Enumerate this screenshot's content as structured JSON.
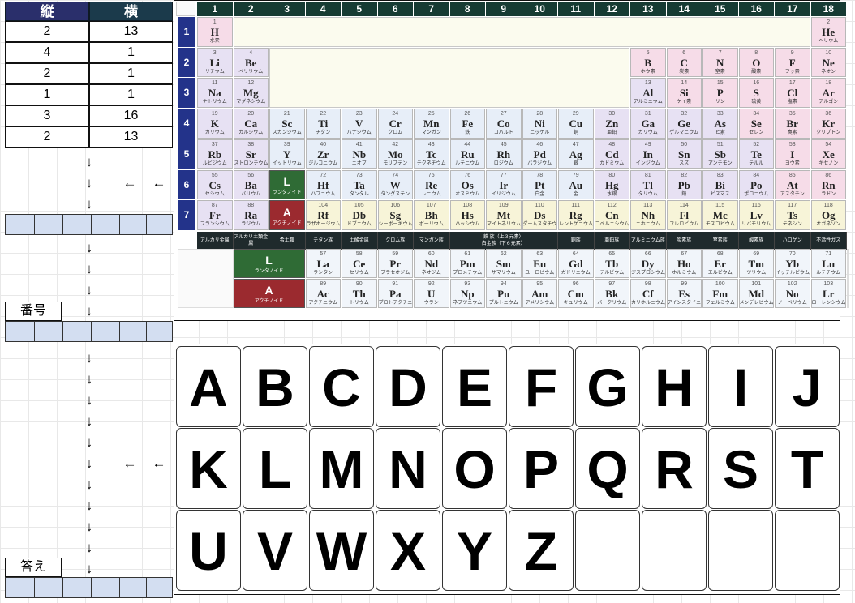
{
  "left": {
    "headers": [
      "縦",
      "横"
    ],
    "coords": [
      [
        "2",
        "13"
      ],
      [
        "4",
        "1"
      ],
      [
        "2",
        "1"
      ],
      [
        "1",
        "1"
      ],
      [
        "3",
        "16"
      ],
      [
        "2",
        "13"
      ]
    ],
    "down_arrow": "↓",
    "left_arrow": "←",
    "label_number": "番号",
    "label_answer": "答え"
  },
  "columns": [
    "1",
    "2",
    "3",
    "4",
    "5",
    "6",
    "7",
    "8",
    "9",
    "10",
    "11",
    "12",
    "13",
    "14",
    "15",
    "16",
    "17",
    "18"
  ],
  "periods": [
    "1",
    "2",
    "3",
    "4",
    "5",
    "6",
    "7"
  ],
  "elements": [
    [
      1,
      1,
      "1",
      "H",
      "水素",
      "hal"
    ],
    [
      1,
      18,
      "2",
      "He",
      "ヘリウム",
      "hal"
    ],
    [
      2,
      1,
      "3",
      "Li",
      "リチウム",
      "ak"
    ],
    [
      2,
      2,
      "4",
      "Be",
      "ベリリウム",
      "ak"
    ],
    [
      2,
      13,
      "5",
      "B",
      "ホウ素",
      "hal"
    ],
    [
      2,
      14,
      "6",
      "C",
      "炭素",
      "hal"
    ],
    [
      2,
      15,
      "7",
      "N",
      "窒素",
      "hal"
    ],
    [
      2,
      16,
      "8",
      "O",
      "酸素",
      "hal"
    ],
    [
      2,
      17,
      "9",
      "F",
      "フッ素",
      "hal"
    ],
    [
      2,
      18,
      "10",
      "Ne",
      "ネオン",
      "hal"
    ],
    [
      3,
      1,
      "11",
      "Na",
      "ナトリウム",
      "ak"
    ],
    [
      3,
      2,
      "12",
      "Mg",
      "マグネシウム",
      "ak"
    ],
    [
      3,
      13,
      "13",
      "Al",
      "アルミニウム",
      "ak"
    ],
    [
      3,
      14,
      "14",
      "Si",
      "ケイ素",
      "hal"
    ],
    [
      3,
      15,
      "15",
      "P",
      "リン",
      "hal"
    ],
    [
      3,
      16,
      "16",
      "S",
      "硫黄",
      "hal"
    ],
    [
      3,
      17,
      "17",
      "Cl",
      "塩素",
      "hal"
    ],
    [
      3,
      18,
      "18",
      "Ar",
      "アルゴン",
      "hal"
    ],
    [
      4,
      1,
      "19",
      "K",
      "カリウム",
      "ak"
    ],
    [
      4,
      2,
      "20",
      "Ca",
      "カルシウム",
      "ak"
    ],
    [
      4,
      3,
      "21",
      "Sc",
      "スカンジウム",
      "tm"
    ],
    [
      4,
      4,
      "22",
      "Ti",
      "チタン",
      "tm"
    ],
    [
      4,
      5,
      "23",
      "V",
      "バナジウム",
      "tm"
    ],
    [
      4,
      6,
      "24",
      "Cr",
      "クロム",
      "tm"
    ],
    [
      4,
      7,
      "25",
      "Mn",
      "マンガン",
      "tm"
    ],
    [
      4,
      8,
      "26",
      "Fe",
      "鉄",
      "tm"
    ],
    [
      4,
      9,
      "27",
      "Co",
      "コバルト",
      "tm"
    ],
    [
      4,
      10,
      "28",
      "Ni",
      "ニッケル",
      "tm"
    ],
    [
      4,
      11,
      "29",
      "Cu",
      "銅",
      "tm"
    ],
    [
      4,
      12,
      "30",
      "Zn",
      "亜鉛",
      "ak"
    ],
    [
      4,
      13,
      "31",
      "Ga",
      "ガリウム",
      "ak"
    ],
    [
      4,
      14,
      "32",
      "Ge",
      "ゲルマニウム",
      "ak"
    ],
    [
      4,
      15,
      "33",
      "As",
      "ヒ素",
      "ak"
    ],
    [
      4,
      16,
      "34",
      "Se",
      "セレン",
      "hal"
    ],
    [
      4,
      17,
      "35",
      "Br",
      "臭素",
      "hal"
    ],
    [
      4,
      18,
      "36",
      "Kr",
      "クリプトン",
      "hal"
    ],
    [
      5,
      1,
      "37",
      "Rb",
      "ルビジウム",
      "ak"
    ],
    [
      5,
      2,
      "38",
      "Sr",
      "ストロンチウム",
      "ak"
    ],
    [
      5,
      3,
      "39",
      "Y",
      "イットリウム",
      "tm"
    ],
    [
      5,
      4,
      "40",
      "Zr",
      "ジルコニウム",
      "tm"
    ],
    [
      5,
      5,
      "41",
      "Nb",
      "ニオブ",
      "tm"
    ],
    [
      5,
      6,
      "42",
      "Mo",
      "モリブデン",
      "tm"
    ],
    [
      5,
      7,
      "43",
      "Tc",
      "テクネチウム",
      "tm"
    ],
    [
      5,
      8,
      "44",
      "Ru",
      "ルテニウム",
      "tm"
    ],
    [
      5,
      9,
      "45",
      "Rh",
      "ロジウム",
      "tm"
    ],
    [
      5,
      10,
      "46",
      "Pd",
      "パラジウム",
      "tm"
    ],
    [
      5,
      11,
      "47",
      "Ag",
      "銀",
      "tm"
    ],
    [
      5,
      12,
      "48",
      "Cd",
      "カドミウム",
      "ak"
    ],
    [
      5,
      13,
      "49",
      "In",
      "インジウム",
      "ak"
    ],
    [
      5,
      14,
      "50",
      "Sn",
      "スズ",
      "ak"
    ],
    [
      5,
      15,
      "51",
      "Sb",
      "アンチモン",
      "ak"
    ],
    [
      5,
      16,
      "52",
      "Te",
      "テルル",
      "ak"
    ],
    [
      5,
      17,
      "53",
      "I",
      "ヨウ素",
      "hal"
    ],
    [
      5,
      18,
      "54",
      "Xe",
      "キセノン",
      "hal"
    ],
    [
      6,
      1,
      "55",
      "Cs",
      "セシウム",
      "ak"
    ],
    [
      6,
      2,
      "56",
      "Ba",
      "バリウム",
      "ak"
    ],
    [
      6,
      4,
      "72",
      "Hf",
      "ハフニウム",
      "tm"
    ],
    [
      6,
      5,
      "73",
      "Ta",
      "タンタル",
      "tm"
    ],
    [
      6,
      6,
      "74",
      "W",
      "タングステン",
      "tm"
    ],
    [
      6,
      7,
      "75",
      "Re",
      "レニウム",
      "tm"
    ],
    [
      6,
      8,
      "76",
      "Os",
      "オスミウム",
      "tm"
    ],
    [
      6,
      9,
      "77",
      "Ir",
      "イリジウム",
      "tm"
    ],
    [
      6,
      10,
      "78",
      "Pt",
      "白金",
      "tm"
    ],
    [
      6,
      11,
      "79",
      "Au",
      "金",
      "tm"
    ],
    [
      6,
      12,
      "80",
      "Hg",
      "水銀",
      "ak"
    ],
    [
      6,
      13,
      "81",
      "Tl",
      "タリウム",
      "ak"
    ],
    [
      6,
      14,
      "82",
      "Pb",
      "鉛",
      "ak"
    ],
    [
      6,
      15,
      "83",
      "Bi",
      "ビスマス",
      "ak"
    ],
    [
      6,
      16,
      "84",
      "Po",
      "ポロニウム",
      "ak"
    ],
    [
      6,
      17,
      "85",
      "At",
      "アスタチン",
      "hal"
    ],
    [
      6,
      18,
      "86",
      "Rn",
      "ラドン",
      "hal"
    ],
    [
      7,
      1,
      "87",
      "Fr",
      "フランシウム",
      "ak"
    ],
    [
      7,
      2,
      "88",
      "Ra",
      "ラジウム",
      "ak"
    ],
    [
      7,
      4,
      "104",
      "Rf",
      "ラザホージウム",
      "sh"
    ],
    [
      7,
      5,
      "105",
      "Db",
      "ドブニウム",
      "sh"
    ],
    [
      7,
      6,
      "106",
      "Sg",
      "シーボーギウム",
      "sh"
    ],
    [
      7,
      7,
      "107",
      "Bh",
      "ボーリウム",
      "sh"
    ],
    [
      7,
      8,
      "108",
      "Hs",
      "ハッシウム",
      "sh"
    ],
    [
      7,
      9,
      "109",
      "Mt",
      "マイトネリウム",
      "sh"
    ],
    [
      7,
      10,
      "110",
      "Ds",
      "ダームスタチウム",
      "sh"
    ],
    [
      7,
      11,
      "111",
      "Rg",
      "レントゲニウム",
      "sh"
    ],
    [
      7,
      12,
      "112",
      "Cn",
      "コペルニシウム",
      "sh"
    ],
    [
      7,
      13,
      "113",
      "Nh",
      "ニホニウム",
      "sh"
    ],
    [
      7,
      14,
      "114",
      "Fl",
      "フレロビウム",
      "sh"
    ],
    [
      7,
      15,
      "115",
      "Mc",
      "モスコビウム",
      "sh"
    ],
    [
      7,
      16,
      "116",
      "Lv",
      "リバモリウム",
      "sh"
    ],
    [
      7,
      17,
      "117",
      "Ts",
      "テネシン",
      "sh"
    ],
    [
      7,
      18,
      "118",
      "Og",
      "オガネソン",
      "sh"
    ]
  ],
  "special": {
    "L": {
      "s": "L",
      "j": "ランタノイド"
    },
    "A": {
      "s": "A",
      "j": "アクチノイド"
    }
  },
  "groups": [
    "アルカリ金属",
    "アルカリ土類金属",
    "希土類",
    "チタン族",
    "土酸金属",
    "クロム族",
    "マンガン族",
    "鉄 族（上３元素）\n白金族（下６元素）",
    "銅族",
    "亜鉛族",
    "アルミニウム族",
    "炭素族",
    "窒素族",
    "酸素族",
    "ハロゲン",
    "不活性ガス"
  ],
  "lanthanides": [
    [
      "57",
      "La",
      "ランタン"
    ],
    [
      "58",
      "Ce",
      "セリウム"
    ],
    [
      "59",
      "Pr",
      "プラセオジム"
    ],
    [
      "60",
      "Nd",
      "ネオジム"
    ],
    [
      "61",
      "Pm",
      "プロメチウム"
    ],
    [
      "62",
      "Sm",
      "サマリウム"
    ],
    [
      "63",
      "Eu",
      "ユーロピウム"
    ],
    [
      "64",
      "Gd",
      "ガドリニウム"
    ],
    [
      "65",
      "Tb",
      "テルビウム"
    ],
    [
      "66",
      "Dy",
      "ジスプロシウム"
    ],
    [
      "67",
      "Ho",
      "ホルミウム"
    ],
    [
      "68",
      "Er",
      "エルビウム"
    ],
    [
      "69",
      "Tm",
      "ツリウム"
    ],
    [
      "70",
      "Yb",
      "イッテルビウム"
    ],
    [
      "71",
      "Lu",
      "ルテチウム"
    ]
  ],
  "actinides": [
    [
      "89",
      "Ac",
      "アクチニウム"
    ],
    [
      "90",
      "Th",
      "トリウム"
    ],
    [
      "91",
      "Pa",
      "プロトアクチニウム"
    ],
    [
      "92",
      "U",
      "ウラン"
    ],
    [
      "93",
      "Np",
      "ネプツニウム"
    ],
    [
      "94",
      "Pu",
      "プルトニウム"
    ],
    [
      "95",
      "Am",
      "アメリシウム"
    ],
    [
      "96",
      "Cm",
      "キュリウム"
    ],
    [
      "97",
      "Bk",
      "バークリウム"
    ],
    [
      "98",
      "Cf",
      "カリホルニウム"
    ],
    [
      "99",
      "Es",
      "アインスタイニウム"
    ],
    [
      "100",
      "Fm",
      "フェルミウム"
    ],
    [
      "101",
      "Md",
      "メンデレビウム"
    ],
    [
      "102",
      "No",
      "ノーベリウム"
    ],
    [
      "103",
      "Lr",
      "ローレンシウム"
    ]
  ],
  "letters": [
    "A",
    "B",
    "C",
    "D",
    "E",
    "F",
    "G",
    "H",
    "I",
    "J",
    "K",
    "L",
    "M",
    "N",
    "O",
    "P",
    "Q",
    "R",
    "S",
    "T",
    "U",
    "V",
    "W",
    "X",
    "Y",
    "Z"
  ],
  "colors": {
    "header": "#163b33",
    "period": "#23338a",
    "lanthanoid": "#2f6b35",
    "actinoid": "#9b2a2f",
    "cell_blue": "#d3def1"
  }
}
